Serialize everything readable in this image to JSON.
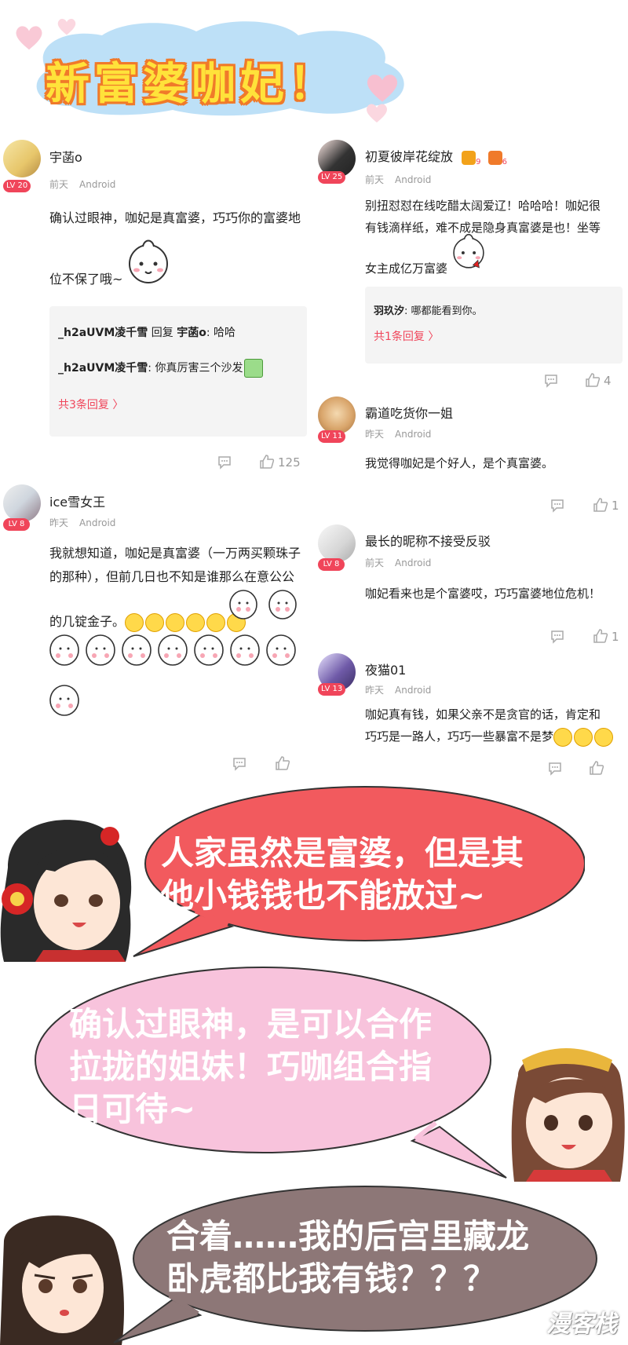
{
  "header": {
    "title": "新富婆咖妃！"
  },
  "colors": {
    "accent": "#f0455a",
    "title_fill": "#ffe23a",
    "title_stroke": "#f07a2a",
    "cloud": "#bde0f7",
    "bubble_red": "#f25a5e",
    "bubble_pink": "#f8c3dc",
    "bubble_gray": "#8d7777"
  },
  "comments_left": [
    {
      "user": "宇菡o",
      "level": "LV 20",
      "time": "前天",
      "device": "Android",
      "text_line1": "确认过眼神，咖妃是真富婆，巧巧你的富婆地",
      "text_line2": "位不保了哦~",
      "replies": [
        {
          "user": "_h2aUVM凌千雪",
          "mid": " 回复 ",
          "target": "宇菡o",
          "text": ": 哈哈"
        },
        {
          "user": "_h2aUVM凌千雪",
          "text": ": 你真厉害三个沙发"
        }
      ],
      "more": "共3条回复 〉",
      "likes": "125"
    },
    {
      "user": "ice雪女王",
      "level": "LV 8",
      "time": "昨天",
      "device": "Android",
      "text_line1": "我就想知道，咖妃是真富婆（一万两买颗珠子",
      "text_line2": "的那种），但前几日也不知是谁那么在意公公",
      "text_line3": "的几锭金子。"
    }
  ],
  "comments_right": [
    {
      "user": "初夏彼岸花绽放",
      "level": "LV 25",
      "badge1": "9",
      "badge2": "6",
      "time": "前天",
      "device": "Android",
      "text_line1": "别扭怼怼在线吃醋太阔爱辽！哈哈哈！咖妃很",
      "text_line2": "有钱滴样纸，难不成是隐身真富婆是也！坐等",
      "text_line3": "女主成亿万富婆",
      "replies": [
        {
          "user": "羽玖汐",
          "text": ": 哪都能看到你。"
        }
      ],
      "more": "共1条回复 〉",
      "likes": "4"
    },
    {
      "user": "霸道吃货你一姐",
      "level": "LV 11",
      "time": "昨天",
      "device": "Android",
      "text_line1": "我觉得咖妃是个好人，是个真富婆。",
      "likes": "1"
    },
    {
      "user": "最长的昵称不接受反驳",
      "level": "LV 8",
      "time": "前天",
      "device": "Android",
      "text_line1": "咖妃看来也是个富婆哎，巧巧富婆地位危机！",
      "likes": "1"
    },
    {
      "user": "夜猫01",
      "level": "LV 13",
      "time": "昨天",
      "device": "Android",
      "text_line1": "咖妃真有钱，如果父亲不是贪官的话，肯定和",
      "text_line2": "巧巧是一路人，巧巧一些暴富不是梦"
    }
  ],
  "bubbles": [
    {
      "line1": "人家虽然是富婆，但是其",
      "line2": "他小钱钱也不能放过~"
    },
    {
      "line1": "确认过眼神，是可以合作",
      "line2": "拉拢的姐妹！巧咖组合指",
      "line3": "日可待~"
    },
    {
      "line1": "合着……我的后宫里藏龙",
      "line2": "卧虎都比我有钱？？？"
    }
  ],
  "watermark": "漫客栈"
}
